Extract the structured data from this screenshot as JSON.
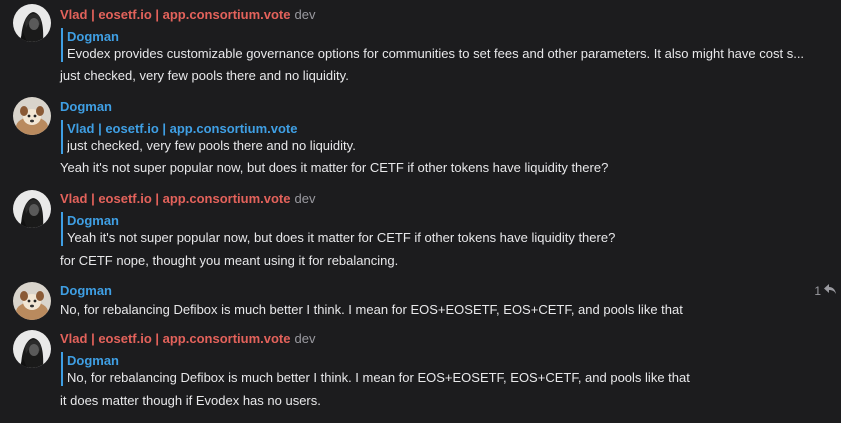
{
  "messages": [
    {
      "author": "Vlad | eosetf.io | app.consortium.vote",
      "tag": "dev",
      "avatar": "vlad-avatar",
      "reply_to": {
        "author": "Dogman",
        "text": "Evodex provides customizable governance options for communities to set fees and other parameters. It also might have cost s..."
      },
      "text": "just checked, very few pools there and no liquidity."
    },
    {
      "author": "Dogman",
      "tag": "",
      "avatar": "dogman-avatar",
      "reply_to": {
        "author": "Vlad | eosetf.io | app.consortium.vote",
        "text": "just checked, very few pools there and no liquidity."
      },
      "text": "Yeah it's not super popular now, but does it matter for CETF if other tokens have liquidity there?"
    },
    {
      "author": "Vlad | eosetf.io | app.consortium.vote",
      "tag": "dev",
      "avatar": "vlad-avatar",
      "reply_to": {
        "author": "Dogman",
        "text": "Yeah it's not super popular now, but does it matter for CETF if other tokens have liquidity there?"
      },
      "text": "for CETF nope, thought you meant using it for rebalancing."
    },
    {
      "author": "Dogman",
      "tag": "",
      "avatar": "dogman-avatar",
      "reply_count": "1",
      "text": "No, for rebalancing Defibox is much better I think. I mean for EOS+EOSETF, EOS+CETF, and pools like that"
    },
    {
      "author": "Vlad | eosetf.io | app.consortium.vote",
      "tag": "dev",
      "avatar": "vlad-avatar",
      "reply_to": {
        "author": "Dogman",
        "text": "No, for rebalancing Defibox is much better I think. I mean for EOS+EOSETF, EOS+CETF, and pools like that"
      },
      "text": "it does matter though if Evodex has no users."
    }
  ],
  "colors": {
    "background": "#1c1c1e",
    "vlad_name": "#e3625b",
    "dogman_name": "#3f9fe4",
    "text": "#e8e8ea",
    "muted": "#9a9aa0"
  }
}
